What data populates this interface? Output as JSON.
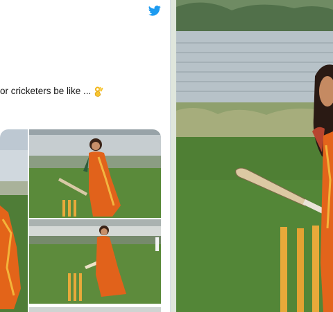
{
  "tweet": {
    "text": "or cricketers be like ...",
    "emoji": "ok-hand-emoji",
    "platform_icon": "twitter-bird-icon"
  },
  "colors": {
    "twitter_blue": "#1d9bf0",
    "saree_orange": "#e0621a",
    "grass_green": "#4e7a35",
    "stump_yellow": "#e8a93a"
  }
}
